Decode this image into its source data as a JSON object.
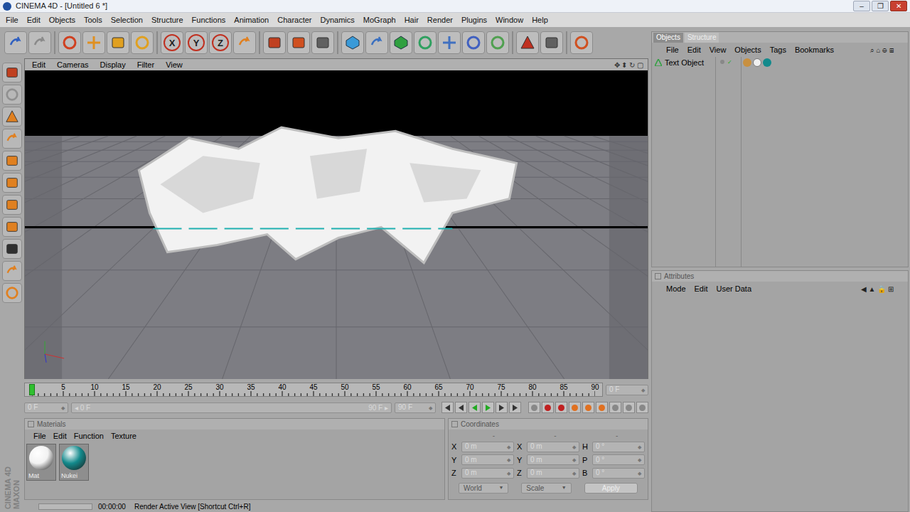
{
  "window": {
    "title": "CINEMA 4D - [Untitled 6 *]",
    "controls": [
      "–",
      "❐",
      "✕"
    ]
  },
  "menu": [
    "File",
    "Edit",
    "Objects",
    "Tools",
    "Selection",
    "Structure",
    "Functions",
    "Animation",
    "Character",
    "Dynamics",
    "MoGraph",
    "Hair",
    "Render",
    "Plugins",
    "Window",
    "Help"
  ],
  "toolbar": {
    "axis_buttons": [
      "X",
      "Y",
      "Z"
    ]
  },
  "viewport": {
    "menu": [
      "Edit",
      "Cameras",
      "Display",
      "Filter",
      "View"
    ]
  },
  "timeline": {
    "ticks": [
      "0",
      "5",
      "10",
      "15",
      "20",
      "25",
      "30",
      "35",
      "40",
      "45",
      "50",
      "55",
      "60",
      "65",
      "70",
      "75",
      "80",
      "85",
      "90"
    ],
    "current": "0 F"
  },
  "playback": {
    "start": "0 F",
    "range_start": "0 F",
    "range_end": "90 F",
    "end": "90 F"
  },
  "materials": {
    "title": "Materials",
    "menu": [
      "File",
      "Edit",
      "Function",
      "Texture"
    ],
    "items": [
      {
        "name": "Mat",
        "color": "#f2f2f2"
      },
      {
        "name": "Nukei",
        "color": "#138a8c"
      }
    ]
  },
  "coordinates": {
    "title": "Coordinates",
    "column_headers": [
      "-",
      "-",
      "-"
    ],
    "rows": [
      {
        "axis": "X",
        "position": "0 m",
        "size_axis": "X",
        "size": "0 m",
        "rot_axis": "H",
        "rotation": "0 °"
      },
      {
        "axis": "Y",
        "position": "0 m",
        "size_axis": "Y",
        "size": "0 m",
        "rot_axis": "P",
        "rotation": "0 °"
      },
      {
        "axis": "Z",
        "position": "0 m",
        "size_axis": "Z",
        "size": "0 m",
        "rot_axis": "B",
        "rotation": "0 °"
      }
    ],
    "mode": "World",
    "size_mode": "Scale",
    "apply": "Apply"
  },
  "status_bar": {
    "time": "00:00:00",
    "message": "Render Active View [Shortcut Ctrl+R]"
  },
  "logo": {
    "lines": [
      "MAXON",
      "CINEMA 4D"
    ]
  },
  "objects_panel": {
    "tabs": [
      {
        "label": "Objects",
        "selected": true
      },
      {
        "label": "Structure",
        "selected": false
      }
    ],
    "menu": [
      "File",
      "Edit",
      "View",
      "Objects",
      "Tags",
      "Bookmarks"
    ],
    "objects": [
      {
        "name": "Text Object",
        "selected": false
      }
    ]
  },
  "attributes": {
    "title": "Attributes",
    "menu": [
      "Mode",
      "Edit",
      "User Data"
    ]
  }
}
